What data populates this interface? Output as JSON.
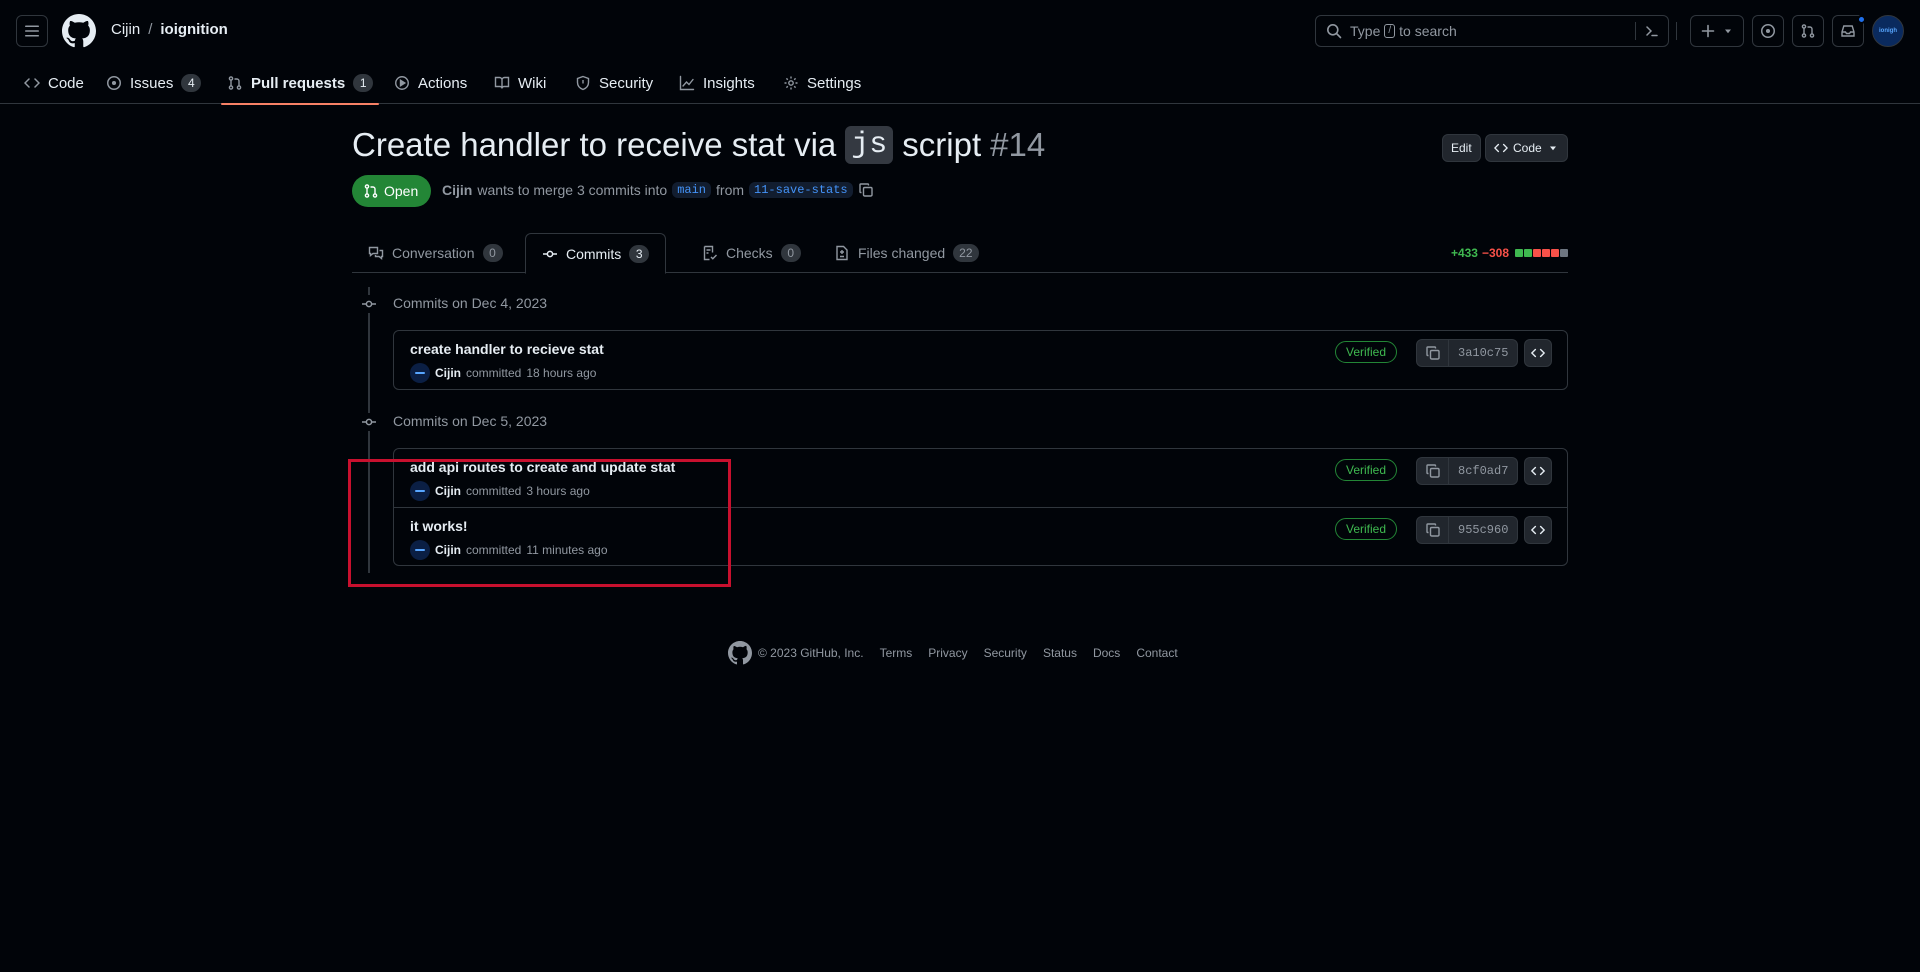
{
  "header": {
    "owner": "Cijin",
    "separator": "/",
    "repo": "ioignition",
    "search_placeholder_before": "Type",
    "search_slash": "/",
    "search_placeholder_after": "to search",
    "avatar_text": "ionigh"
  },
  "repo_nav": [
    {
      "label": "Code",
      "icon": "code-icon"
    },
    {
      "label": "Issues",
      "count": "4",
      "icon": "issue-icon"
    },
    {
      "label": "Pull requests",
      "count": "1",
      "icon": "pull-request-icon",
      "active": true
    },
    {
      "label": "Actions",
      "icon": "play-icon"
    },
    {
      "label": "Wiki",
      "icon": "book-icon"
    },
    {
      "label": "Security",
      "icon": "shield-icon"
    },
    {
      "label": "Insights",
      "icon": "graph-icon"
    },
    {
      "label": "Settings",
      "icon": "gear-icon"
    }
  ],
  "pr": {
    "title_before": "Create handler to receive stat via",
    "title_code": "js",
    "title_after": "script",
    "number": "#14",
    "edit_label": "Edit",
    "code_label": "Code",
    "state": "Open",
    "author": "Cijin",
    "merge_text": "wants to merge 3 commits into",
    "base_branch": "main",
    "from_text": "from",
    "head_branch": "11-save-stats"
  },
  "tabs": [
    {
      "label": "Conversation",
      "count": "0",
      "icon": "comment-discussion-icon"
    },
    {
      "label": "Commits",
      "count": "3",
      "icon": "commit-icon",
      "active": true
    },
    {
      "label": "Checks",
      "count": "0",
      "icon": "checklist-icon"
    },
    {
      "label": "Files changed",
      "count": "22",
      "icon": "file-diff-icon"
    }
  ],
  "diffstat": {
    "additions": "+433",
    "deletions": "−308",
    "blocks": [
      "#3fb950",
      "#3fb950",
      "#f85149",
      "#f85149",
      "#f85149",
      "#6e7681"
    ]
  },
  "commit_groups": [
    {
      "label": "Commits on Dec 4, 2023",
      "commits": [
        {
          "message": "create handler to recieve stat",
          "author": "Cijin",
          "action": "committed",
          "time": "18 hours ago",
          "badge": "Verified",
          "sha": "3a10c75"
        }
      ]
    },
    {
      "label": "Commits on Dec 5, 2023",
      "commits": [
        {
          "message": "add api routes to create and update stat",
          "author": "Cijin",
          "action": "committed",
          "time": "3 hours ago",
          "badge": "Verified",
          "sha": "8cf0ad7"
        },
        {
          "message": "it works!",
          "author": "Cijin",
          "action": "committed",
          "time": "11 minutes ago",
          "badge": "Verified",
          "sha": "955c960"
        }
      ]
    }
  ],
  "footer": {
    "copyright": "© 2023 GitHub, Inc.",
    "links": [
      "Terms",
      "Privacy",
      "Security",
      "Status",
      "Docs",
      "Contact"
    ]
  },
  "colors": {
    "accent_underline": "#f78166",
    "open_green": "#238636",
    "highlight_red": "#c8102e"
  }
}
